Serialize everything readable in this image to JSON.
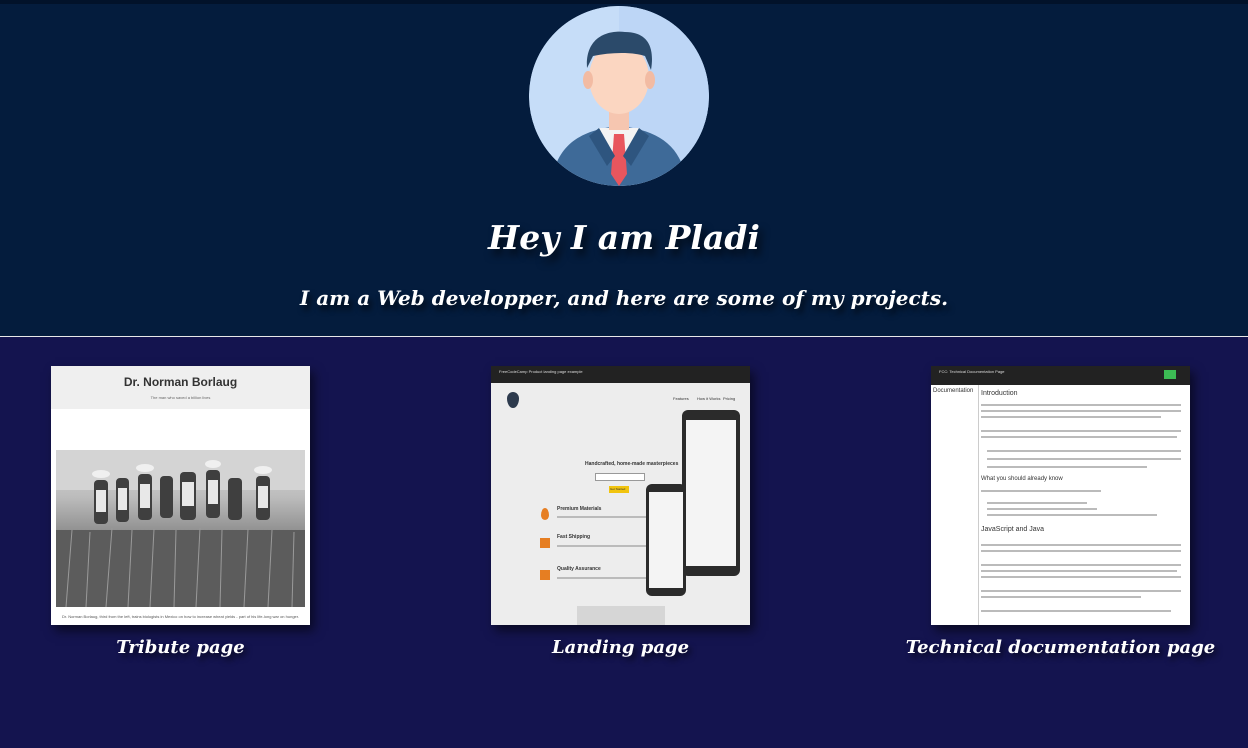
{
  "hero": {
    "title": "Hey I am Pladi",
    "subtitle": "I am a Web developper, and here are some of my projects."
  },
  "projects": [
    {
      "label": "Tribute page",
      "thumb": {
        "title": "Dr. Norman Borlaug",
        "subtitle": "The man who saved a billion lives",
        "caption": "Dr. Norman Borlaug, third from the left, trains biologists in Mexico on how to increase wheat yields - part of his life-long war on hunger."
      }
    },
    {
      "label": "Landing page",
      "thumb": {
        "bar_title": "FreeCodeCamp Product landing page example",
        "nav": [
          "Features",
          "How it Works",
          "Pricing"
        ],
        "headline": "Handcrafted, home-made masterpieces",
        "cta": "Get Started",
        "features": [
          "Premium Materials",
          "Fast Shipping",
          "Quality Assurance"
        ]
      }
    },
    {
      "label": "Technical documentation page",
      "thumb": {
        "bar_title": "FCC: Technical Documentation Page",
        "side_title": "Documentation",
        "headings": [
          "Introduction",
          "What you should already know",
          "JavaScript and Java"
        ]
      }
    }
  ],
  "colors": {
    "hero_bg": "#041c3d",
    "projects_bg": "#14144f"
  }
}
